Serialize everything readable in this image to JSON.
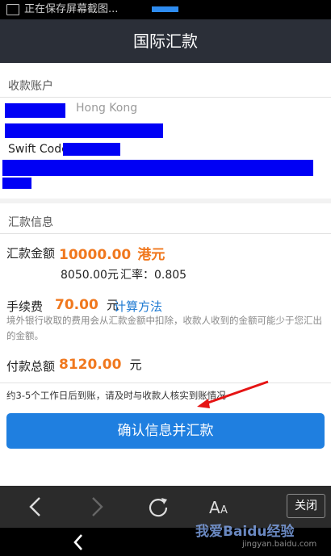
{
  "statusbar": {
    "notification": "正在保存屏幕截图..."
  },
  "header": {
    "title": "国际汇款"
  },
  "payee": {
    "section_title": "收款账户",
    "country": "Hong Kong",
    "swift_label": "Swift Code:"
  },
  "transfer": {
    "section_title": "汇款信息",
    "amount_label": "汇款金额",
    "amount_value": "10000.00",
    "amount_currency": "港元",
    "converted": "8050.00元",
    "rate": "汇率：0.805",
    "fee_label": "手续费",
    "fee_value": "70.00",
    "fee_unit": "元",
    "fee_link": "计算方法",
    "fee_note": "境外银行收取的费用会从汇款金额中扣除，收款人收到的金额可能少于您汇出的金额。",
    "total_label": "付款总额",
    "total_value": "8120.00",
    "total_unit": "元",
    "arrival_note": "约3-5个工作日后到账，请及时与收款人核实到账情况",
    "confirm_button": "确认信息并汇款"
  },
  "toolbar": {
    "back_icon": "chevron-left-icon",
    "forward_icon": "chevron-right-icon",
    "refresh_icon": "refresh-icon",
    "font_icon": "font-size-icon",
    "close_label": "关闭"
  },
  "navbar": {
    "back_icon": "nav-back-icon"
  },
  "watermark": {
    "text": "我爱Baidu经验",
    "sub": "jingyan.baidu.com"
  },
  "colors": {
    "accent": "#1f7fe0",
    "orange": "#f0781e",
    "redaction": "#0000f5",
    "header_bg": "#2b2f38"
  }
}
